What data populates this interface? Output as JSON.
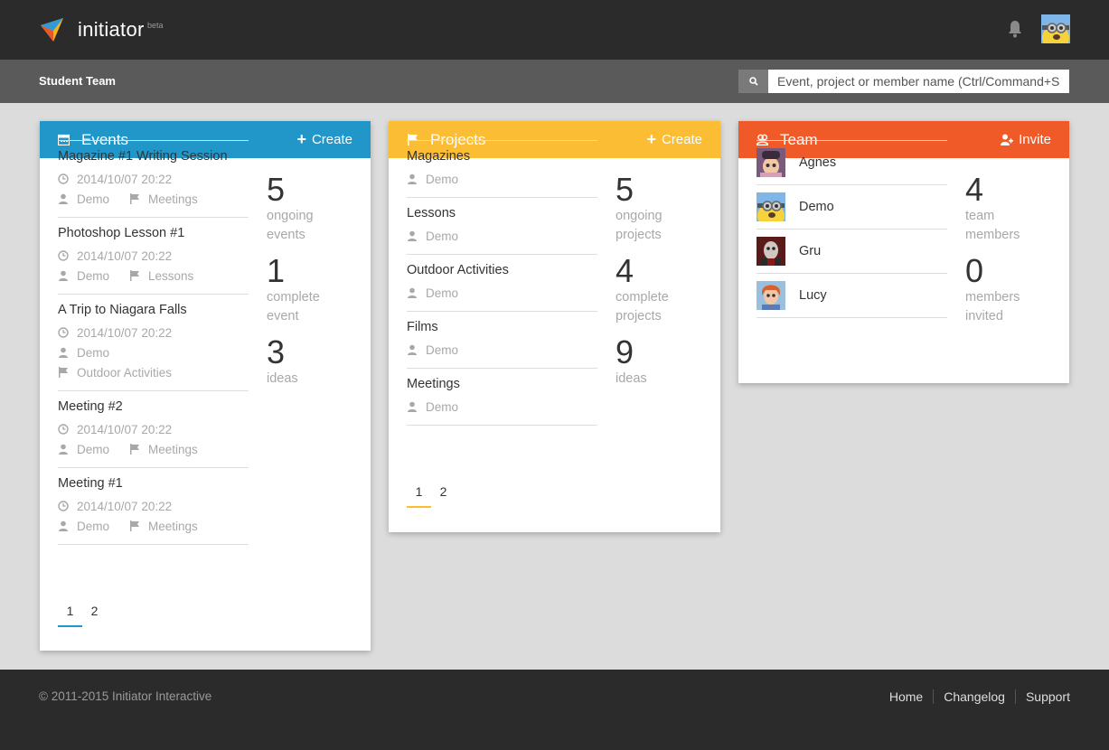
{
  "colors": {
    "events": "#2196c9",
    "projects": "#fbbd33",
    "team": "#f05a28",
    "topbar": "#2b2b2b",
    "subbar": "#5a5a5a"
  },
  "header": {
    "brand": "initiator",
    "beta": "beta",
    "bell_icon": "bell-icon"
  },
  "subbar": {
    "team_name": "Student Team",
    "search_placeholder": "Event, project or member name (Ctrl/Command+Sh"
  },
  "events": {
    "title": "Events",
    "action": "Create",
    "items": [
      {
        "title": "Magazine #1 Writing Session",
        "date": "2014/10/07 20:22",
        "owner": "Demo",
        "project": "Meetings"
      },
      {
        "title": "Photoshop Lesson #1",
        "date": "2014/10/07 20:22",
        "owner": "Demo",
        "project": "Lessons"
      },
      {
        "title": "A Trip to Niagara Falls",
        "date": "2014/10/07 20:22",
        "owner": "Demo",
        "project": "Outdoor Activities"
      },
      {
        "title": "Meeting #2",
        "date": "2014/10/07 20:22",
        "owner": "Demo",
        "project": "Meetings"
      },
      {
        "title": "Meeting #1",
        "date": "2014/10/07 20:22",
        "owner": "Demo",
        "project": "Meetings"
      }
    ],
    "stats": [
      {
        "num": "5",
        "label1": "ongoing",
        "label2": "events"
      },
      {
        "num": "1",
        "label1": "complete",
        "label2": "event"
      },
      {
        "num": "3",
        "label1": "ideas",
        "label2": ""
      }
    ],
    "pages": [
      "1",
      "2"
    ]
  },
  "projects": {
    "title": "Projects",
    "action": "Create",
    "items": [
      {
        "title": "Magazines",
        "owner": "Demo"
      },
      {
        "title": "Lessons",
        "owner": "Demo"
      },
      {
        "title": "Outdoor Activities",
        "owner": "Demo"
      },
      {
        "title": "Films",
        "owner": "Demo"
      },
      {
        "title": "Meetings",
        "owner": "Demo"
      }
    ],
    "stats": [
      {
        "num": "5",
        "label1": "ongoing",
        "label2": "projects"
      },
      {
        "num": "4",
        "label1": "complete",
        "label2": "projects"
      },
      {
        "num": "9",
        "label1": "ideas",
        "label2": ""
      }
    ],
    "pages": [
      "1",
      "2"
    ]
  },
  "team": {
    "title": "Team",
    "action": "Invite",
    "members": [
      "Agnes",
      "Demo",
      "Gru",
      "Lucy"
    ],
    "stats": [
      {
        "num": "4",
        "label1": "team",
        "label2": "members"
      },
      {
        "num": "0",
        "label1": "members",
        "label2": "invited"
      }
    ]
  },
  "footer": {
    "copyright": "© 2011-2015 Initiator Interactive",
    "links": [
      "Home",
      "Changelog",
      "Support"
    ]
  }
}
